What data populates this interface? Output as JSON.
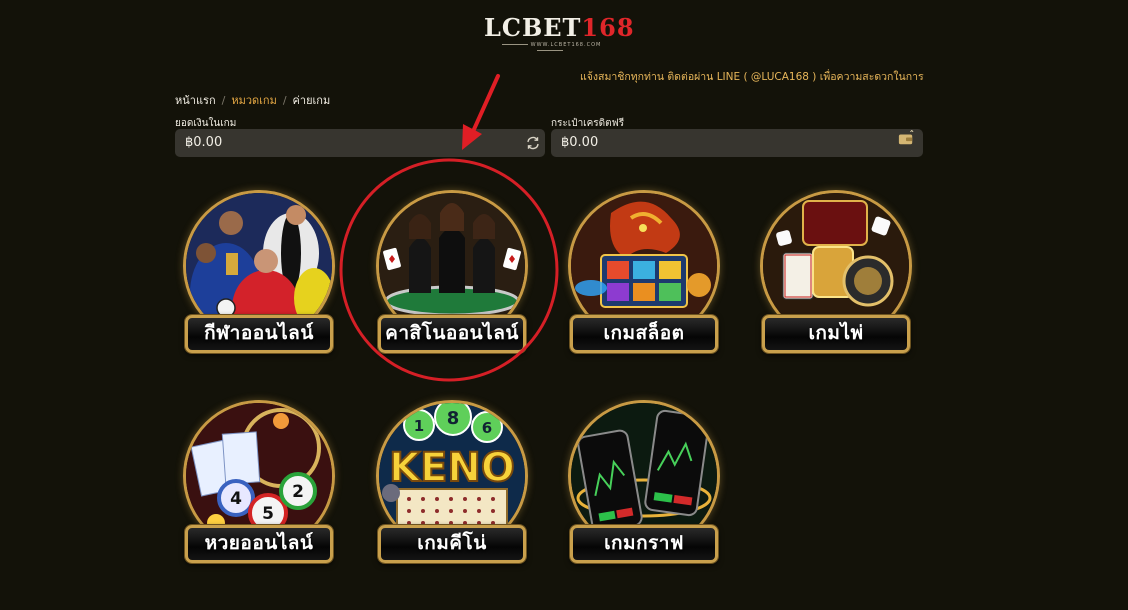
{
  "logo": {
    "brand_white": "LCBET",
    "brand_red": "168",
    "subtext": "WWW.LCBET168.COM"
  },
  "marquee": {
    "text": "แจ้งสมาชิกทุกท่าน ติดต่อผ่าน LINE ( @LUCA168 ) เพื่อความสะดวกในการใช้งาน"
  },
  "breadcrumb": {
    "items": [
      {
        "label": "หน้าแรก"
      },
      {
        "label": "หมวดเกม"
      },
      {
        "label": "ค่ายเกม"
      }
    ]
  },
  "wallets": {
    "main": {
      "label": "ยอดเงินในเกม",
      "value": "฿0.00",
      "icon": "refresh-icon"
    },
    "credit": {
      "label": "กระเป๋าเครดิตฟรี",
      "value": "฿0.00",
      "icon": "wallet-icon"
    }
  },
  "categories": [
    {
      "label": "กีฬาออนไลน์",
      "icon": "football-players-icon"
    },
    {
      "label": "คาสิโนออนไลน์",
      "icon": "casino-dealers-icon"
    },
    {
      "label": "เกมสล็อต",
      "icon": "slot-dragon-icon"
    },
    {
      "label": "เกมไพ่",
      "icon": "playing-cards-icon"
    },
    {
      "label": "หวยออนไลน์",
      "icon": "lottery-balls-icon"
    },
    {
      "label": "เกมคีโน่",
      "icon": "keno-icon"
    },
    {
      "label": "เกมกราฟ",
      "icon": "graph-phones-icon"
    }
  ],
  "keno": {
    "word": "KENO",
    "ball_1": "1",
    "ball_2": "8",
    "ball_3": "6"
  },
  "lottery": {
    "ball_a": "4",
    "ball_b": "5",
    "ball_c": "2"
  },
  "colors": {
    "accent": "#e5a844",
    "background": "#131209",
    "tile_border": "#c9a04c",
    "annotation_red": "#d51f26"
  }
}
